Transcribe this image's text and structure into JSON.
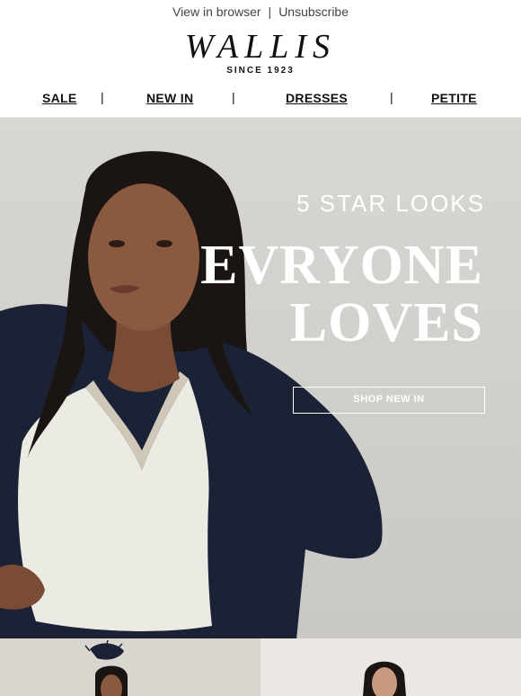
{
  "topbar": {
    "view_in_browser": "View in browser",
    "separator": "|",
    "unsubscribe": "Unsubscribe"
  },
  "brand": {
    "name": "WALLIS",
    "since": "SINCE 1923"
  },
  "nav": {
    "items": [
      {
        "label": "SALE"
      },
      {
        "label": "NEW IN"
      },
      {
        "label": "DRESSES"
      },
      {
        "label": "PETITE"
      }
    ],
    "separator": "|"
  },
  "hero": {
    "kicker": "5 STAR LOOKS",
    "headline_line1": "EVRYONE",
    "headline_line2": "LOVES",
    "cta": "SHOP NEW IN"
  },
  "colors": {
    "hero_background": "#d3d2ce",
    "hero_text": "#ffffff",
    "jacket": "#1b2236",
    "top": "#ecebe3"
  }
}
